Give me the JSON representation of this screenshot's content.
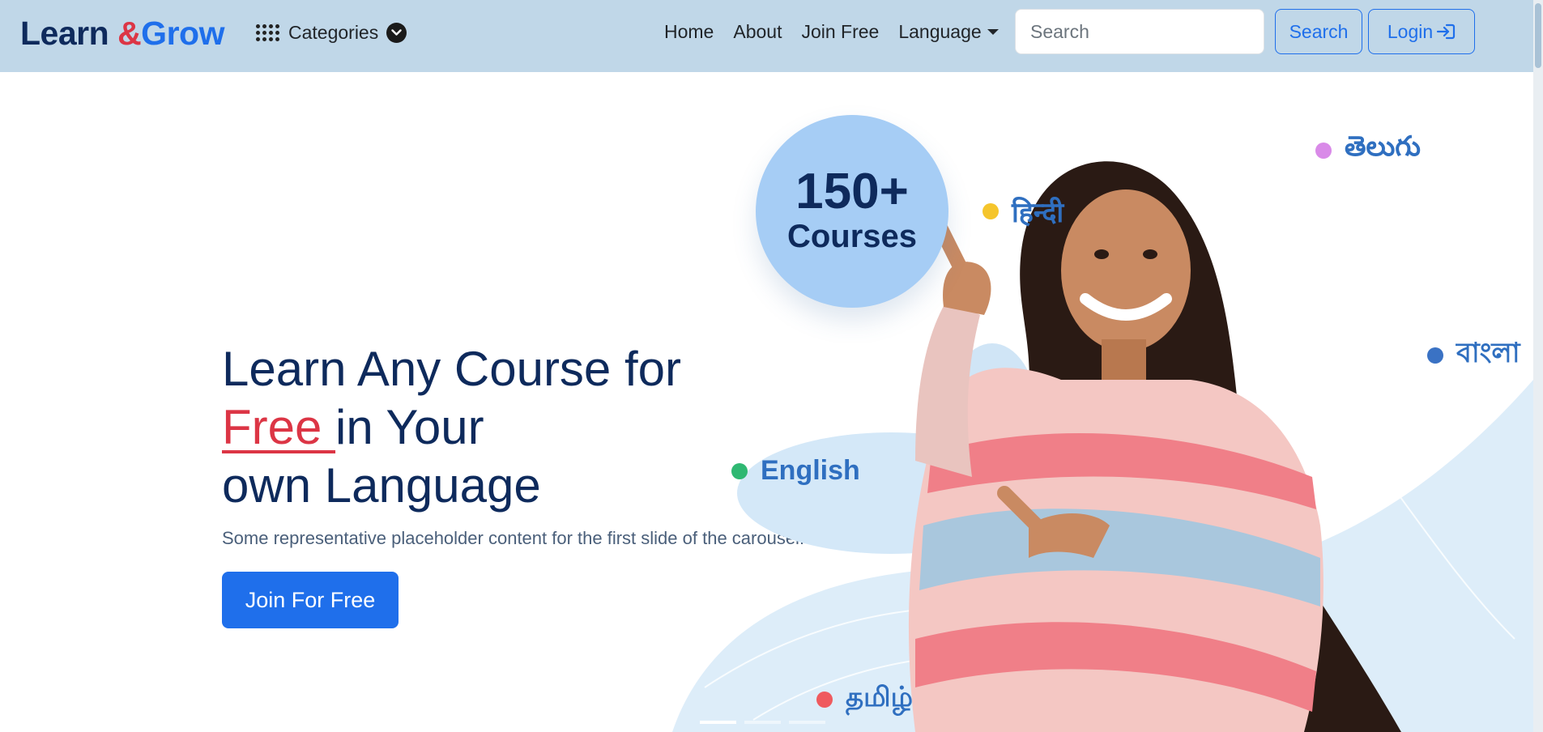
{
  "navbar": {
    "brand": {
      "part1": "Learn",
      "part2": "&",
      "part3": "Grow"
    },
    "categories_label": "Categories",
    "links": {
      "home": "Home",
      "about": "About",
      "join": "Join Free",
      "language": "Language"
    },
    "search_placeholder": "Search",
    "search_button": "Search",
    "login_button": "Login"
  },
  "hero": {
    "title_line1": "Learn Any Course for",
    "title_free": "Free ",
    "title_line2_rest": "in Your",
    "title_line3": "own Language",
    "subtitle": "Some representative placeholder content for the first slide of the carousel.",
    "cta_button": "Join For Free"
  },
  "illustration": {
    "badge_number": "150+",
    "badge_text": "Courses",
    "languages": {
      "telugu": "తెలుగు",
      "hindi": "हिन्दी",
      "bangla": "বাংলা",
      "english": "English",
      "tamil": "தமிழ்"
    },
    "dot_colors": {
      "telugu": "#d98ae8",
      "hindi": "#f5c52c",
      "bangla": "#3a72c4",
      "english": "#2fb872",
      "tamil": "#ef5a5e"
    }
  },
  "carousel": {
    "slide_count": 3,
    "active_slide": 1
  },
  "icons": {
    "categories": "grid-dots-icon",
    "categories_toggle": "chevron-down-circle-icon",
    "language_toggle": "caret-down-icon",
    "login": "box-arrow-in-right-icon",
    "next": "chevron-right-icon"
  },
  "colors": {
    "navbar_bg": "#c0d7e8",
    "primary": "#1f6feb",
    "brand_dark": "#0e2a5c",
    "accent_red": "#dc3545"
  }
}
